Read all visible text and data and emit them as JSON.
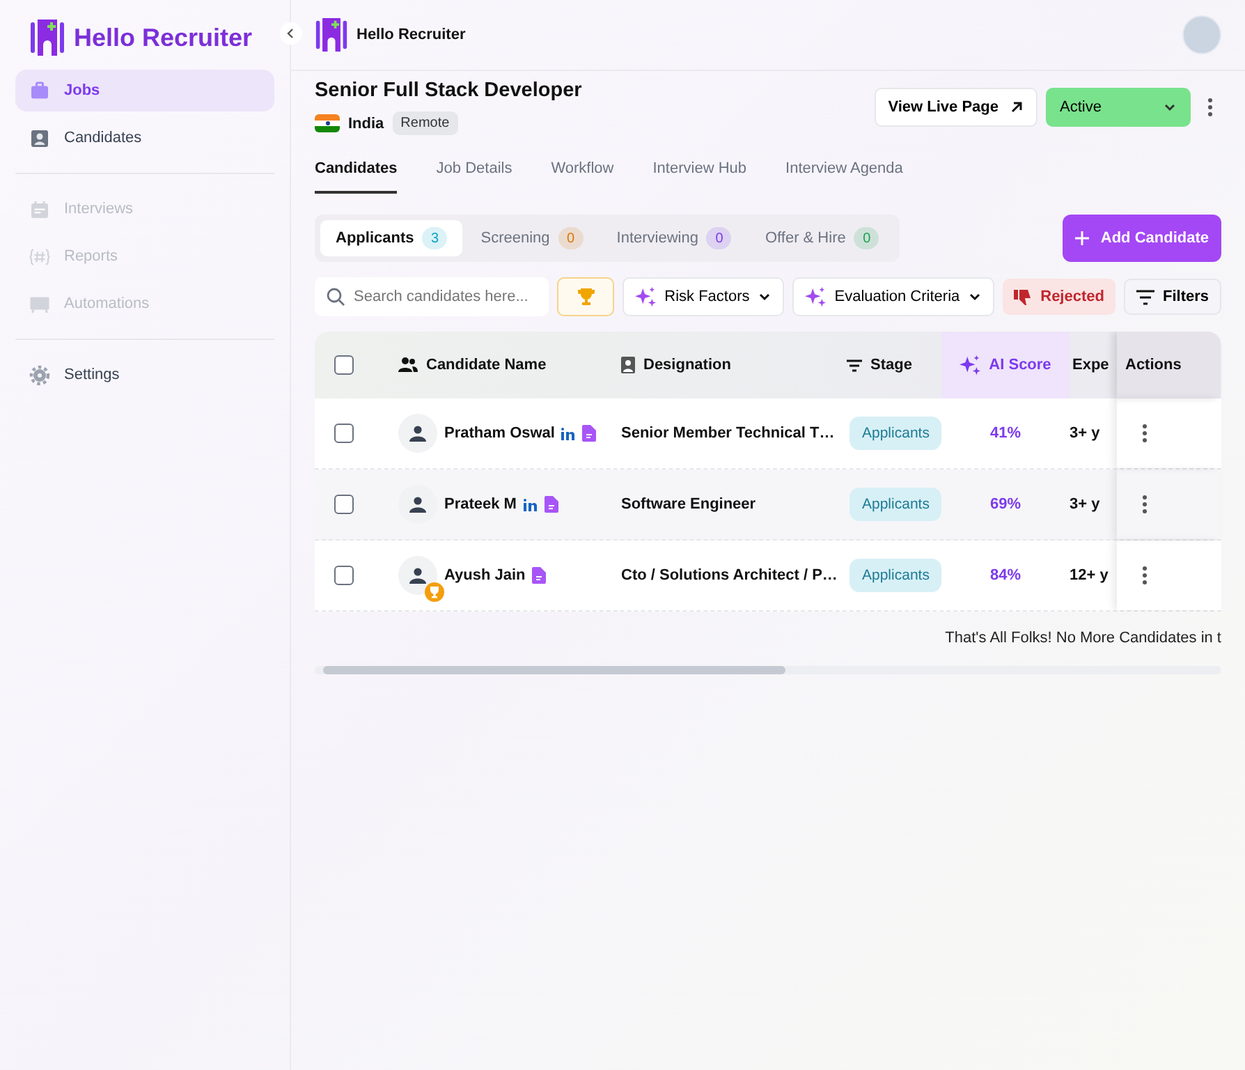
{
  "sidebar": {
    "brand": "Hello Recruiter",
    "sections": [
      {
        "items": [
          {
            "label": "Jobs",
            "selected": true,
            "disabled": false
          },
          {
            "label": "Candidates",
            "selected": false,
            "disabled": false
          }
        ]
      },
      {
        "items": [
          {
            "label": "Interviews",
            "selected": false,
            "disabled": true
          },
          {
            "label": "Reports",
            "selected": false,
            "disabled": true
          },
          {
            "label": "Automations",
            "selected": false,
            "disabled": true
          }
        ]
      },
      {
        "items": [
          {
            "label": "Settings",
            "selected": false,
            "disabled": false
          }
        ]
      }
    ]
  },
  "topbar": {
    "title": "Hello Recruiter"
  },
  "job": {
    "title": "Senior Full Stack Developer",
    "country": "India",
    "work_mode": "Remote",
    "view_button": "View Live Page",
    "status": "Active"
  },
  "tabs": [
    {
      "label": "Candidates",
      "selected": true
    },
    {
      "label": "Job Details",
      "selected": false
    },
    {
      "label": "Workflow",
      "selected": false
    },
    {
      "label": "Interview Hub",
      "selected": false
    },
    {
      "label": "Interview Agenda",
      "selected": false
    }
  ],
  "stage_tabs": [
    {
      "label": "Applicants",
      "count": "3",
      "color": "#0ea5c6",
      "selected": true
    },
    {
      "label": "Screening",
      "count": "0",
      "color": "#d97706",
      "selected": false
    },
    {
      "label": "Interviewing",
      "count": "0",
      "color": "#7c3aed",
      "selected": false
    },
    {
      "label": "Offer & Hire",
      "count": "0",
      "color": "#16a34a",
      "selected": false
    }
  ],
  "add_button": "Add Candidate",
  "search": {
    "placeholder": "Search candidates here..."
  },
  "filters": [
    {
      "label": "Risk Factors"
    },
    {
      "label": "Evaluation Criteria"
    }
  ],
  "rejected_button": "Rejected",
  "filters_button": "Filters",
  "table": {
    "all_checked": false,
    "columns": [
      "Candidate Name",
      "Designation",
      "Stage",
      "AI Score",
      "Expe",
      "Actions"
    ],
    "rows": [
      {
        "name": "Pratham Oswal",
        "linkedin": true,
        "top_pick": false,
        "hovered": false,
        "designation": "Senior Member Technical T…",
        "stage": "Applicants",
        "score": "41%",
        "experience": "3+ y",
        "checked": false
      },
      {
        "name": "Prateek M",
        "linkedin": true,
        "top_pick": false,
        "hovered": true,
        "designation": "Software Engineer",
        "stage": "Applicants",
        "score": "69%",
        "experience": "3+ y",
        "checked": false
      },
      {
        "name": "Ayush Jain",
        "linkedin": false,
        "top_pick": true,
        "hovered": false,
        "designation": "Cto / Solutions Architect / P…",
        "stage": "Applicants",
        "score": "84%",
        "experience": "12+ y",
        "checked": false
      }
    ]
  },
  "footer_note": "That's All Folks! No More Candidates in t"
}
